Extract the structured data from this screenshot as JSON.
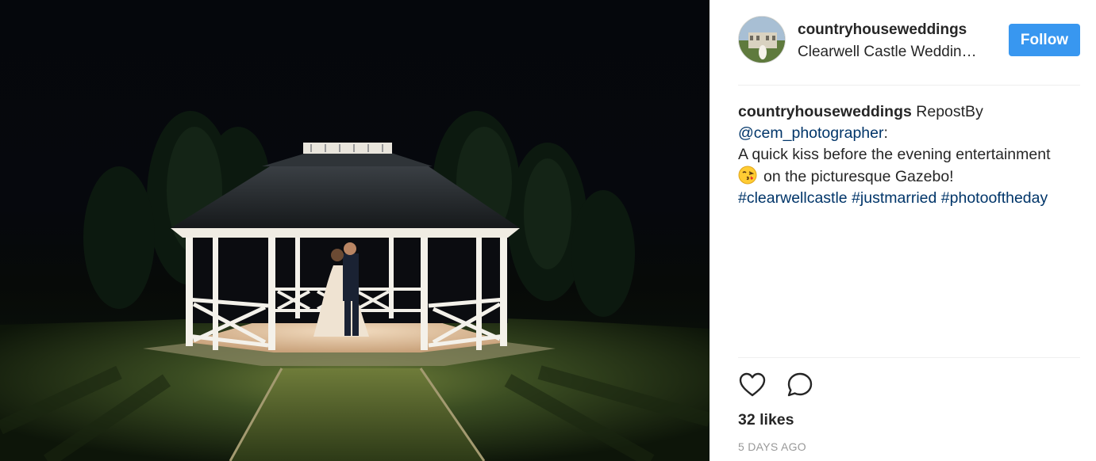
{
  "photo": {
    "subject": "gazebo-wedding-kiss"
  },
  "header": {
    "username": "countryhouseweddings",
    "location": "Clearwell Castle Weddin…",
    "follow_label": "Follow"
  },
  "caption": {
    "username": "countryhouseweddings",
    "text_1": " RepostBy ",
    "mention": "@cem_photographer",
    "text_2": ":",
    "line_3": "A quick kiss before the evening entertainment",
    "emoji_icon": "kissing-face-emoji",
    "line_4": "on the picturesque Gazebo!",
    "hashtags": [
      "#clearwellcastle",
      "#justmarried",
      "#photooftheday"
    ]
  },
  "actions": {
    "like_icon": "heart-outline-icon",
    "comment_icon": "comment-bubble-icon",
    "likes": "32 likes",
    "time": "5 DAYS AGO"
  },
  "colors": {
    "follow_button": "#3897f0",
    "link": "#003569",
    "divider": "#efefef",
    "muted": "#999999"
  }
}
